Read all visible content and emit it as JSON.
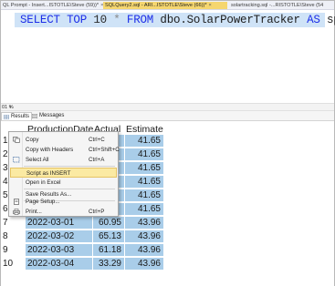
{
  "tabs": [
    {
      "label": "QL Prompt - Insert...ISTOTLE\\Steve (59))*",
      "close": "×",
      "active": false
    },
    {
      "label": "SQLQuery2.sql - ARI...ISTOTLE\\Steve (66))*",
      "close": "×",
      "active": true
    },
    {
      "label": "solartracking.sql -...RISTOTLE\\Steve (54",
      "close": "",
      "active": false
    }
  ],
  "editor": {
    "tokens": {
      "select": "SELECT",
      "top": "TOP",
      "ten": "10",
      "star": "*",
      "from": "FROM",
      "table": "dbo.SolarPowerTracker",
      "as": "AS",
      "alias": "spt"
    }
  },
  "zoom": {
    "value": "01 %"
  },
  "result_tabs": [
    {
      "label": "Results",
      "icon": "grid-icon",
      "active": true
    },
    {
      "label": "Messages",
      "icon": "messages-icon",
      "active": false
    }
  ],
  "grid": {
    "columns": [
      "ProductionDate",
      "Actual",
      "Estimate"
    ],
    "rows": [
      {
        "n": "1",
        "date": "",
        "actual": "",
        "estimate": "41.65"
      },
      {
        "n": "2",
        "date": "",
        "actual": "",
        "estimate": "41.65"
      },
      {
        "n": "3",
        "date": "",
        "actual": "",
        "estimate": "41.65"
      },
      {
        "n": "4",
        "date": "",
        "actual": "",
        "estimate": "41.65"
      },
      {
        "n": "5",
        "date": "",
        "actual": "",
        "estimate": "41.65"
      },
      {
        "n": "6",
        "date": "",
        "actual": "",
        "estimate": "41.65"
      },
      {
        "n": "7",
        "date": "2022-03-01",
        "actual": "60.95",
        "estimate": "43.96"
      },
      {
        "n": "8",
        "date": "2022-03-02",
        "actual": "65.13",
        "estimate": "43.96"
      },
      {
        "n": "9",
        "date": "2022-03-03",
        "actual": "61.18",
        "estimate": "43.96"
      },
      {
        "n": "10",
        "date": "2022-03-04",
        "actual": "33.29",
        "estimate": "43.96"
      }
    ]
  },
  "context_menu": {
    "items": [
      {
        "key": "copy",
        "label": "Copy",
        "shortcut": "Ctrl+C",
        "icon": "copy-icon"
      },
      {
        "key": "copy-with-headers",
        "label": "Copy with Headers",
        "shortcut": "Ctrl+Shift+C",
        "icon": ""
      },
      {
        "key": "select-all",
        "label": "Select All",
        "shortcut": "Ctrl+A",
        "icon": "select-all-icon"
      },
      {
        "key": "script-as-insert",
        "label": "Script as INSERT",
        "shortcut": "",
        "icon": "",
        "hover": true
      },
      {
        "key": "open-in-excel",
        "label": "Open in Excel",
        "shortcut": "",
        "icon": ""
      },
      {
        "key": "save-results-as",
        "label": "Save Results As...",
        "shortcut": "",
        "icon": ""
      },
      {
        "key": "page-setup",
        "label": "Page Setup...",
        "shortcut": "",
        "icon": "page-setup-icon"
      },
      {
        "key": "print",
        "label": "Print...",
        "shortcut": "Ctrl+P",
        "icon": "print-icon"
      }
    ]
  },
  "colors": {
    "tab_active": "#f5d66f",
    "keyword": "#1d2ee8",
    "line_highlight": "#cfe3f7",
    "cell_selection": "#a9cde9",
    "menu_hover": "#fbeaa3"
  }
}
